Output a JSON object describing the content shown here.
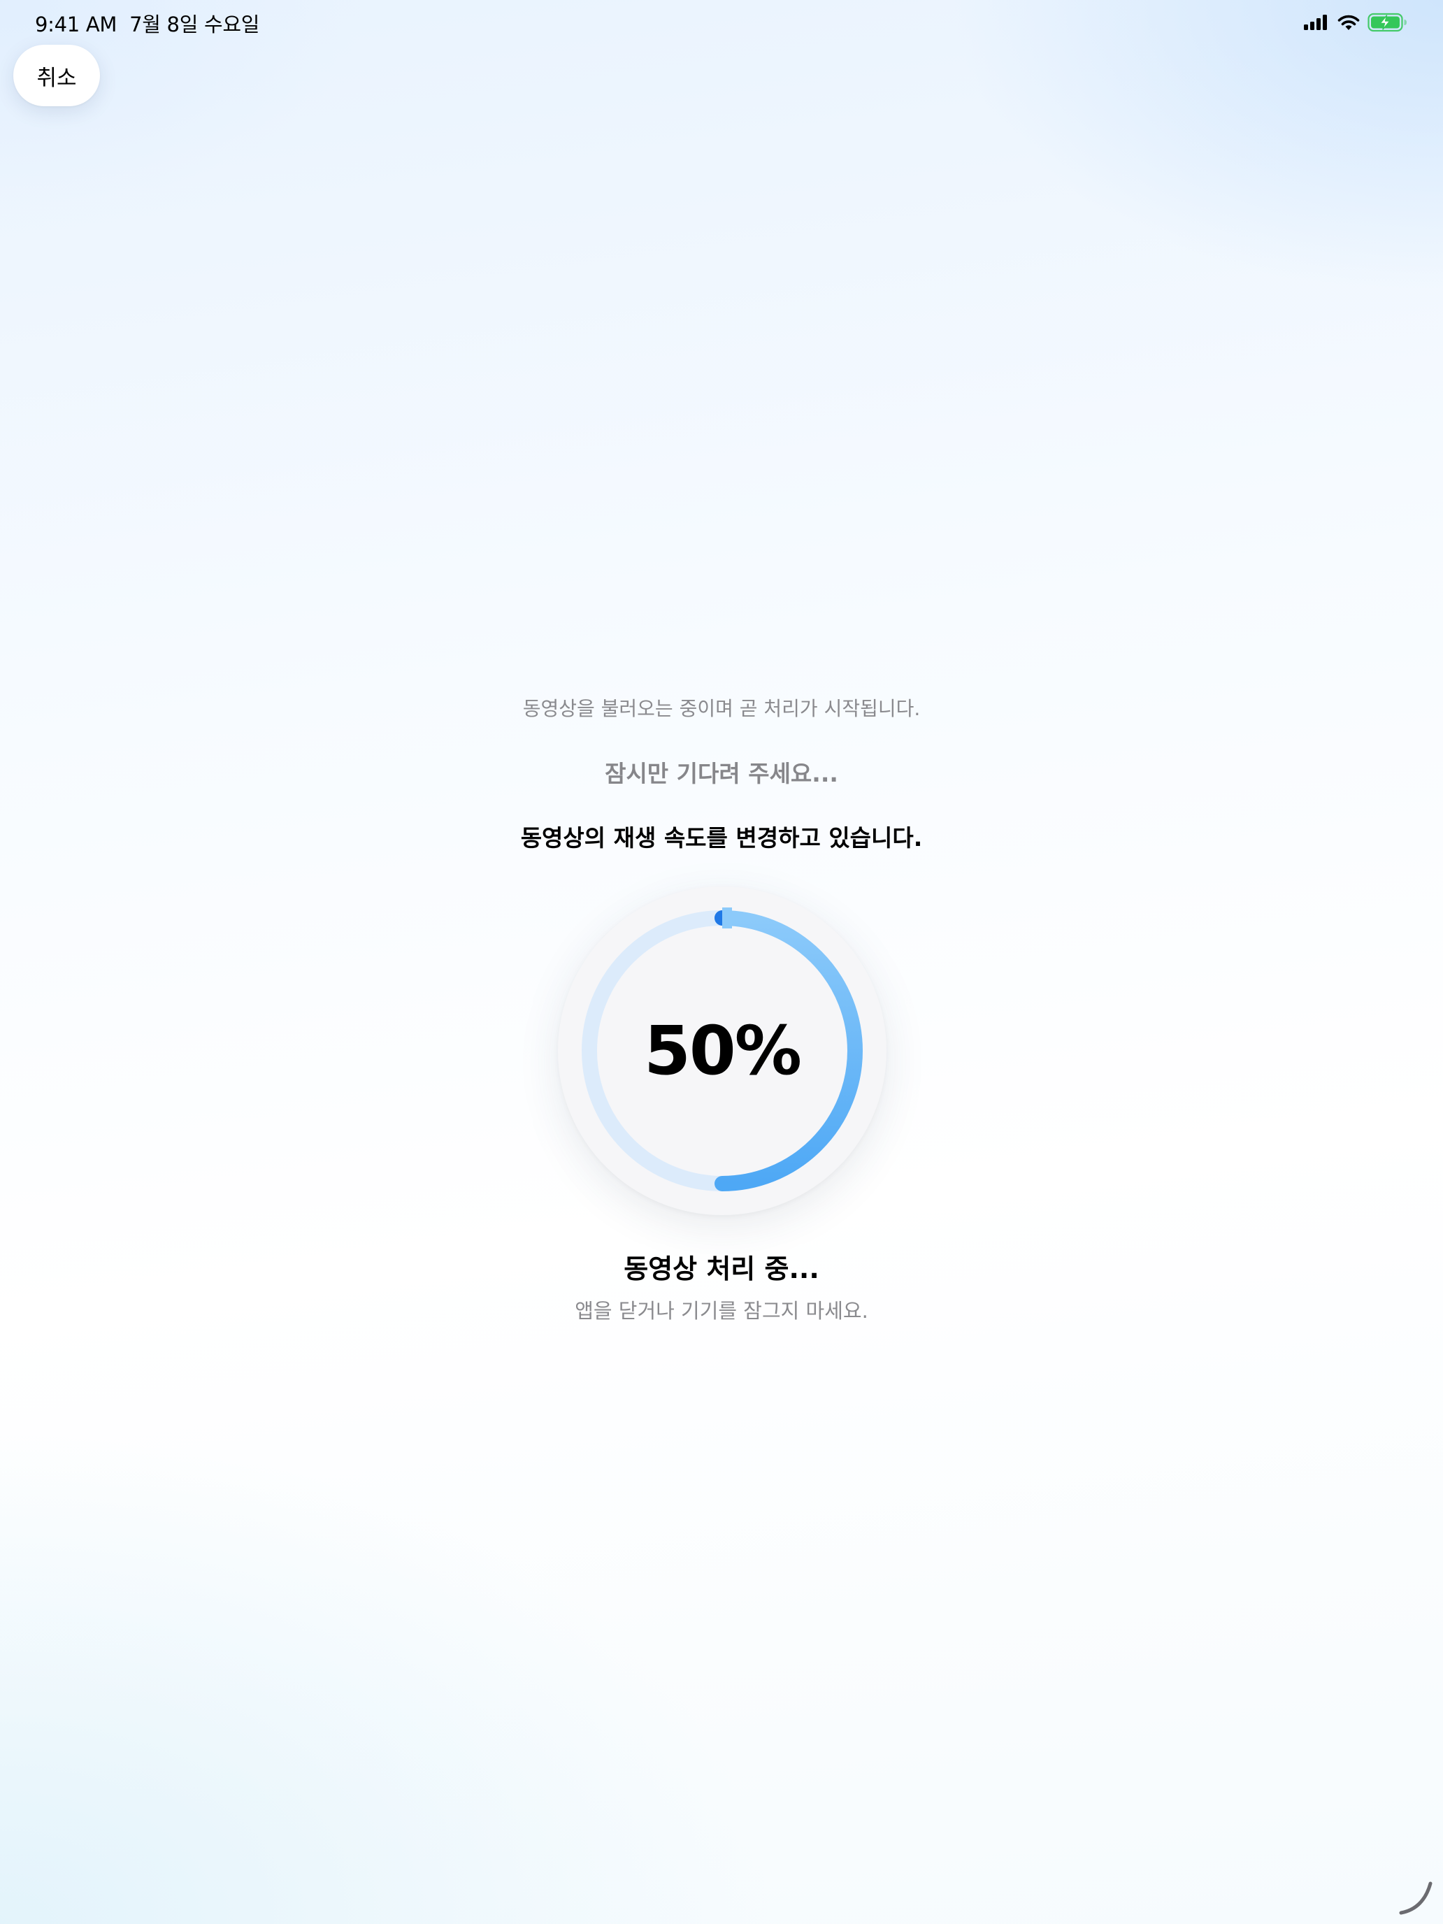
{
  "status_bar": {
    "time": "9:41 AM",
    "date": "7월 8일 수요일"
  },
  "toolbar": {
    "cancel_label": "취소"
  },
  "messages": {
    "loading": "동영상을 불러오는 중이며 곧 처리가 시작됩니다.",
    "wait": "잠시만 기다려 주세요...",
    "speed_change": "동영상의 재생 속도를 변경하고 있습니다."
  },
  "progress": {
    "value": 0.5,
    "label": "50%"
  },
  "processing": {
    "title": "동영상 처리 중...",
    "subtitle": "앱을 닫거나 기기를 잠그지 마세요."
  },
  "colors": {
    "accent_start": "#1f78e6",
    "accent_mid": "#8ccafa",
    "accent_end": "#4ea8f5",
    "track": "#dcebfb",
    "battery": "#34c759"
  },
  "icons": {
    "signal": "cellular-signal-icon",
    "wifi": "wifi-icon",
    "battery": "battery-charging-icon"
  }
}
